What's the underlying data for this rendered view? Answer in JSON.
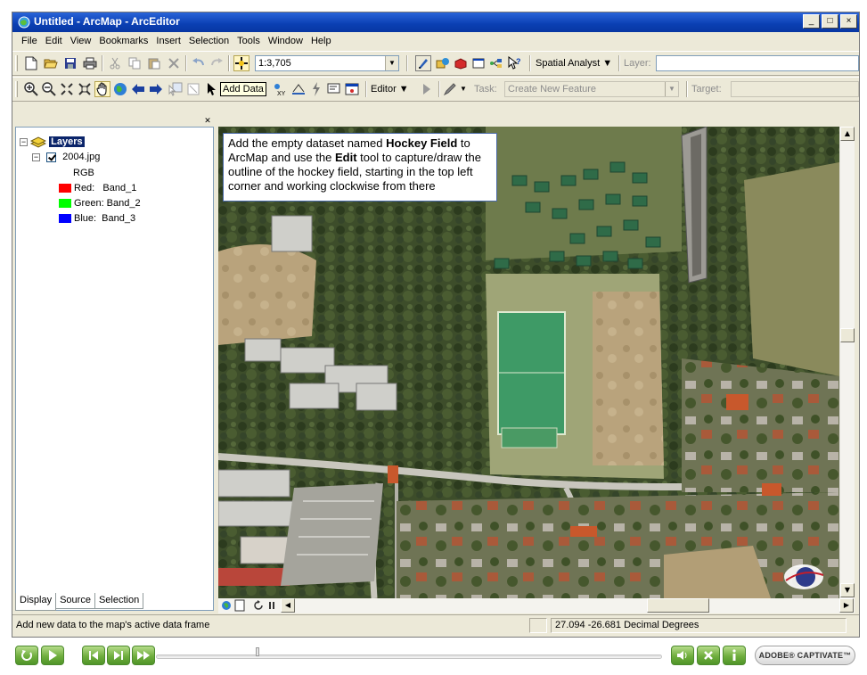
{
  "window": {
    "title": "Untitled - ArcMap - ArcEditor",
    "controls": [
      "_",
      "□",
      "×"
    ]
  },
  "menu": {
    "items": [
      "File",
      "Edit",
      "View",
      "Bookmarks",
      "Insert",
      "Selection",
      "Tools",
      "Window",
      "Help"
    ]
  },
  "standard_toolbar": {
    "scale_value": "1:3,705",
    "spatial_analyst_label": "Spatial Analyst ▼",
    "layer_label": "Layer:"
  },
  "tools_toolbar": {
    "tooltip": "Add Data",
    "editor_label": "Editor ▼",
    "task_label": "Task:",
    "task_value": "Create New Feature",
    "target_label": "Target:"
  },
  "toc": {
    "root_label": "Layers",
    "layer_name": "2004.jpg",
    "rgb_label": "RGB",
    "bands": [
      {
        "label": "Red:   Band_1",
        "color": "#ff0000"
      },
      {
        "label": "Green: Band_2",
        "color": "#00ff00"
      },
      {
        "label": "Blue:  Band_3",
        "color": "#0000ff"
      }
    ],
    "tabs": [
      "Display",
      "Source",
      "Selection"
    ]
  },
  "instruction": {
    "part1": "Add the empty dataset named ",
    "bold1": "Hockey Field",
    "part2": " to ArcMap and use the ",
    "bold2": "Edit",
    "part3": " tool to capture/draw the outline of the hockey field, starting in the top left corner and working clockwise from there"
  },
  "status": {
    "message": "Add new data to the map's active data frame",
    "coordinates": "27.094  -26.681 Decimal Degrees"
  },
  "player": {
    "brand": "ADOBE® CAPTIVATE™"
  },
  "colors": {
    "titlebar": "#0a3fb3",
    "chrome": "#ece9d8",
    "player_green": "#6fae3d"
  }
}
